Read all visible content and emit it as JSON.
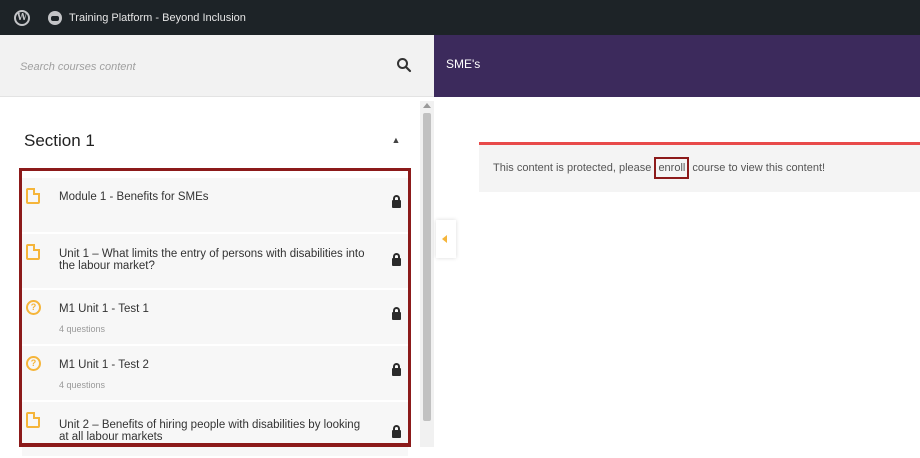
{
  "adminbar": {
    "wp_logo_icon": "wordpress-icon",
    "site_icon": "site-icon",
    "site_title": "Training Platform - Beyond Inclusion"
  },
  "sidebar": {
    "search": {
      "placeholder": "Search courses content",
      "icon": "search-icon"
    },
    "section": {
      "title": "Section 1",
      "toggle_icon": "chevron-up-icon"
    },
    "items": [
      {
        "title": "Module 1 - Benefits for SMEs",
        "subtitle": "",
        "icon": "document-icon",
        "locked": true
      },
      {
        "title": "Unit 1 – What limits the entry of persons with disabilities into the labour market?",
        "subtitle": "",
        "icon": "document-icon",
        "locked": true
      },
      {
        "title": "M1 Unit 1 - Test 1",
        "subtitle": "4 questions",
        "icon": "quiz-icon",
        "locked": true
      },
      {
        "title": "M1 Unit 1 - Test 2",
        "subtitle": "4 questions",
        "icon": "quiz-icon",
        "locked": true
      },
      {
        "title": "Unit 2 – Benefits of hiring people with disabilities by looking at all labour markets",
        "subtitle": "",
        "icon": "document-icon",
        "locked": true
      }
    ]
  },
  "main": {
    "course_title": "SME's",
    "notice": {
      "before": "This content is protected, please ",
      "link": "enroll",
      "after": " course to view this content!"
    }
  },
  "colors": {
    "adminbar": "#1d2327",
    "header_purple": "#3c2a5c",
    "highlight_border": "#8c1a1a",
    "icon_orange": "#f5b53a",
    "notice_border": "#e84a4a"
  }
}
